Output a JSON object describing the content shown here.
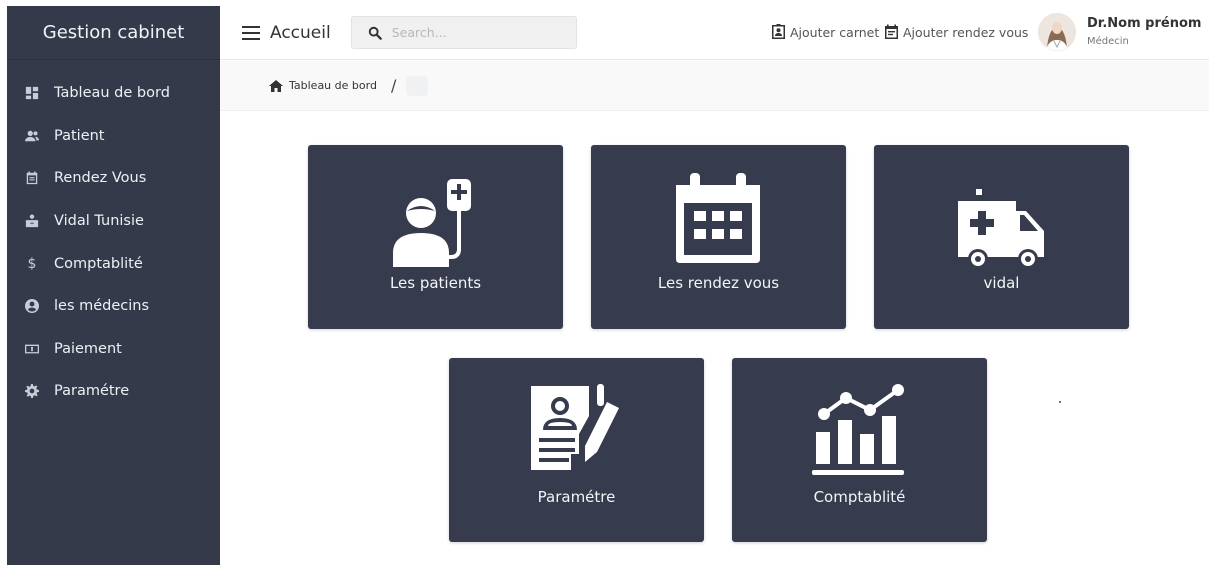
{
  "sidebar": {
    "brand": "Gestion cabinet",
    "items": [
      {
        "label": "Tableau de bord",
        "icon": "dashboard-icon"
      },
      {
        "label": "Patient",
        "icon": "users-icon"
      },
      {
        "label": "Rendez Vous",
        "icon": "calendar-icon"
      },
      {
        "label": "Vidal Tunisie",
        "icon": "medicine-icon"
      },
      {
        "label": "Comptablité",
        "icon": "dollar-icon"
      },
      {
        "label": "les médecins",
        "icon": "user-circle-icon"
      },
      {
        "label": "Paiement",
        "icon": "banknote-icon"
      },
      {
        "label": "Paramétre",
        "icon": "gear-icon"
      }
    ]
  },
  "topbar": {
    "page_title": "Accueil",
    "search_placeholder": "Search...",
    "add_carnet_label": "Ajouter carnet",
    "add_appointment_label": "Ajouter rendez vous",
    "user_name": "Dr.Nom prénom",
    "user_role": "Médecin"
  },
  "breadcrumb": {
    "home_label": "Tableau de bord",
    "separator": "/"
  },
  "tiles": [
    {
      "label": "Les patients",
      "icon": "patient-iv-icon"
    },
    {
      "label": "Les rendez vous",
      "icon": "calendar-icon"
    },
    {
      "label": "vidal",
      "icon": "ambulance-icon"
    },
    {
      "label": "Paramétre",
      "icon": "file-signature-icon"
    },
    {
      "label": "Comptablité",
      "icon": "chart-icon"
    }
  ],
  "colors": {
    "sidebar_bg": "#343a4a",
    "tile_bg": "#363b4d",
    "text_light": "#eef0f4"
  }
}
